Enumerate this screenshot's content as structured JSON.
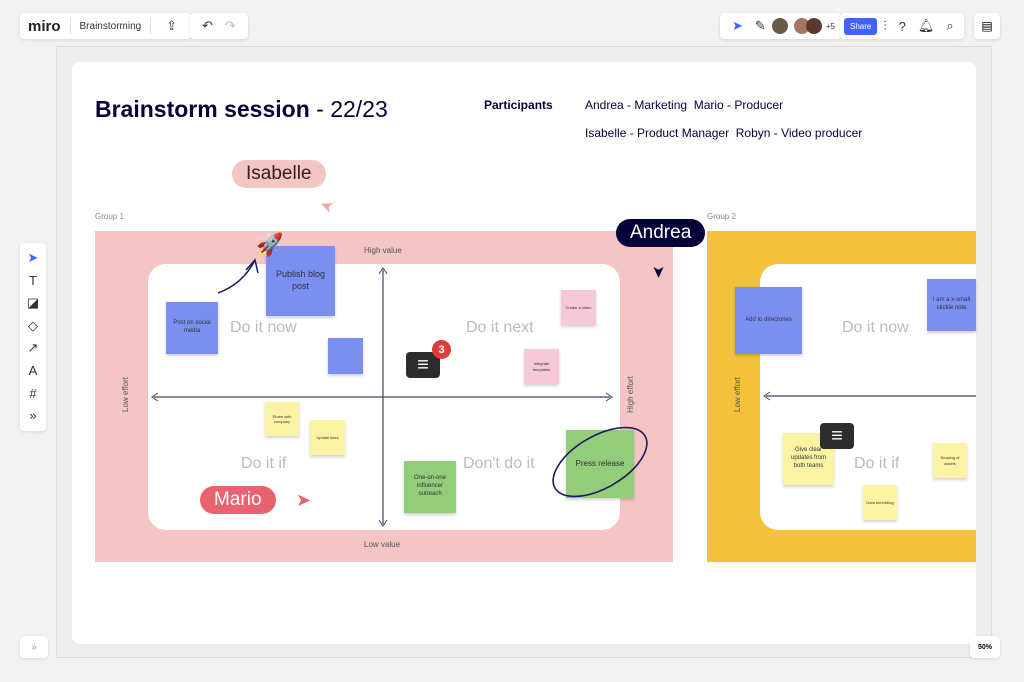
{
  "toolbar": {
    "logo": "miro",
    "board_name": "Brainstorming",
    "extra_collaborators": "+5",
    "share_label": "Share",
    "zoom": "50%"
  },
  "colors": {
    "accent": "#4262ff",
    "group1": "#f4c5c5",
    "group2": "#f4c13d"
  },
  "title": {
    "bold": "Brainstorm session",
    "light": " - 22/23"
  },
  "participants": {
    "label": "Participants",
    "line1": "Andrea - Marketing  Mario - Producer",
    "line2": "Isabelle - Product Manager  Robyn - Video producer"
  },
  "cursors": {
    "isabelle": "Isabelle",
    "andrea": "Andrea",
    "mario": "Mario"
  },
  "group1": {
    "label": "Group 1",
    "high_value": "High value",
    "low_value": "Low value",
    "low_effort": "Low effort",
    "high_effort": "High effort",
    "quadrants": [
      "Do it now",
      "Do it next",
      "Do it if",
      "Don't do it"
    ],
    "stickies": [
      "Publish blog post",
      "Post on social media",
      "",
      "Create a video",
      "Integrate templates",
      "Share with company",
      "Update lines",
      "One-on-one influencer outreach",
      "Press release"
    ],
    "comment_count": "3"
  },
  "group2": {
    "label": "Group 2",
    "low_effort": "Low effort",
    "quadrants": [
      "Do it now",
      "Do it if"
    ],
    "stickies": [
      "Add to directories",
      "I am a x-small stickie note",
      "Give clear updates from both teams",
      "Scoping of assets",
      "Data shredding"
    ]
  }
}
